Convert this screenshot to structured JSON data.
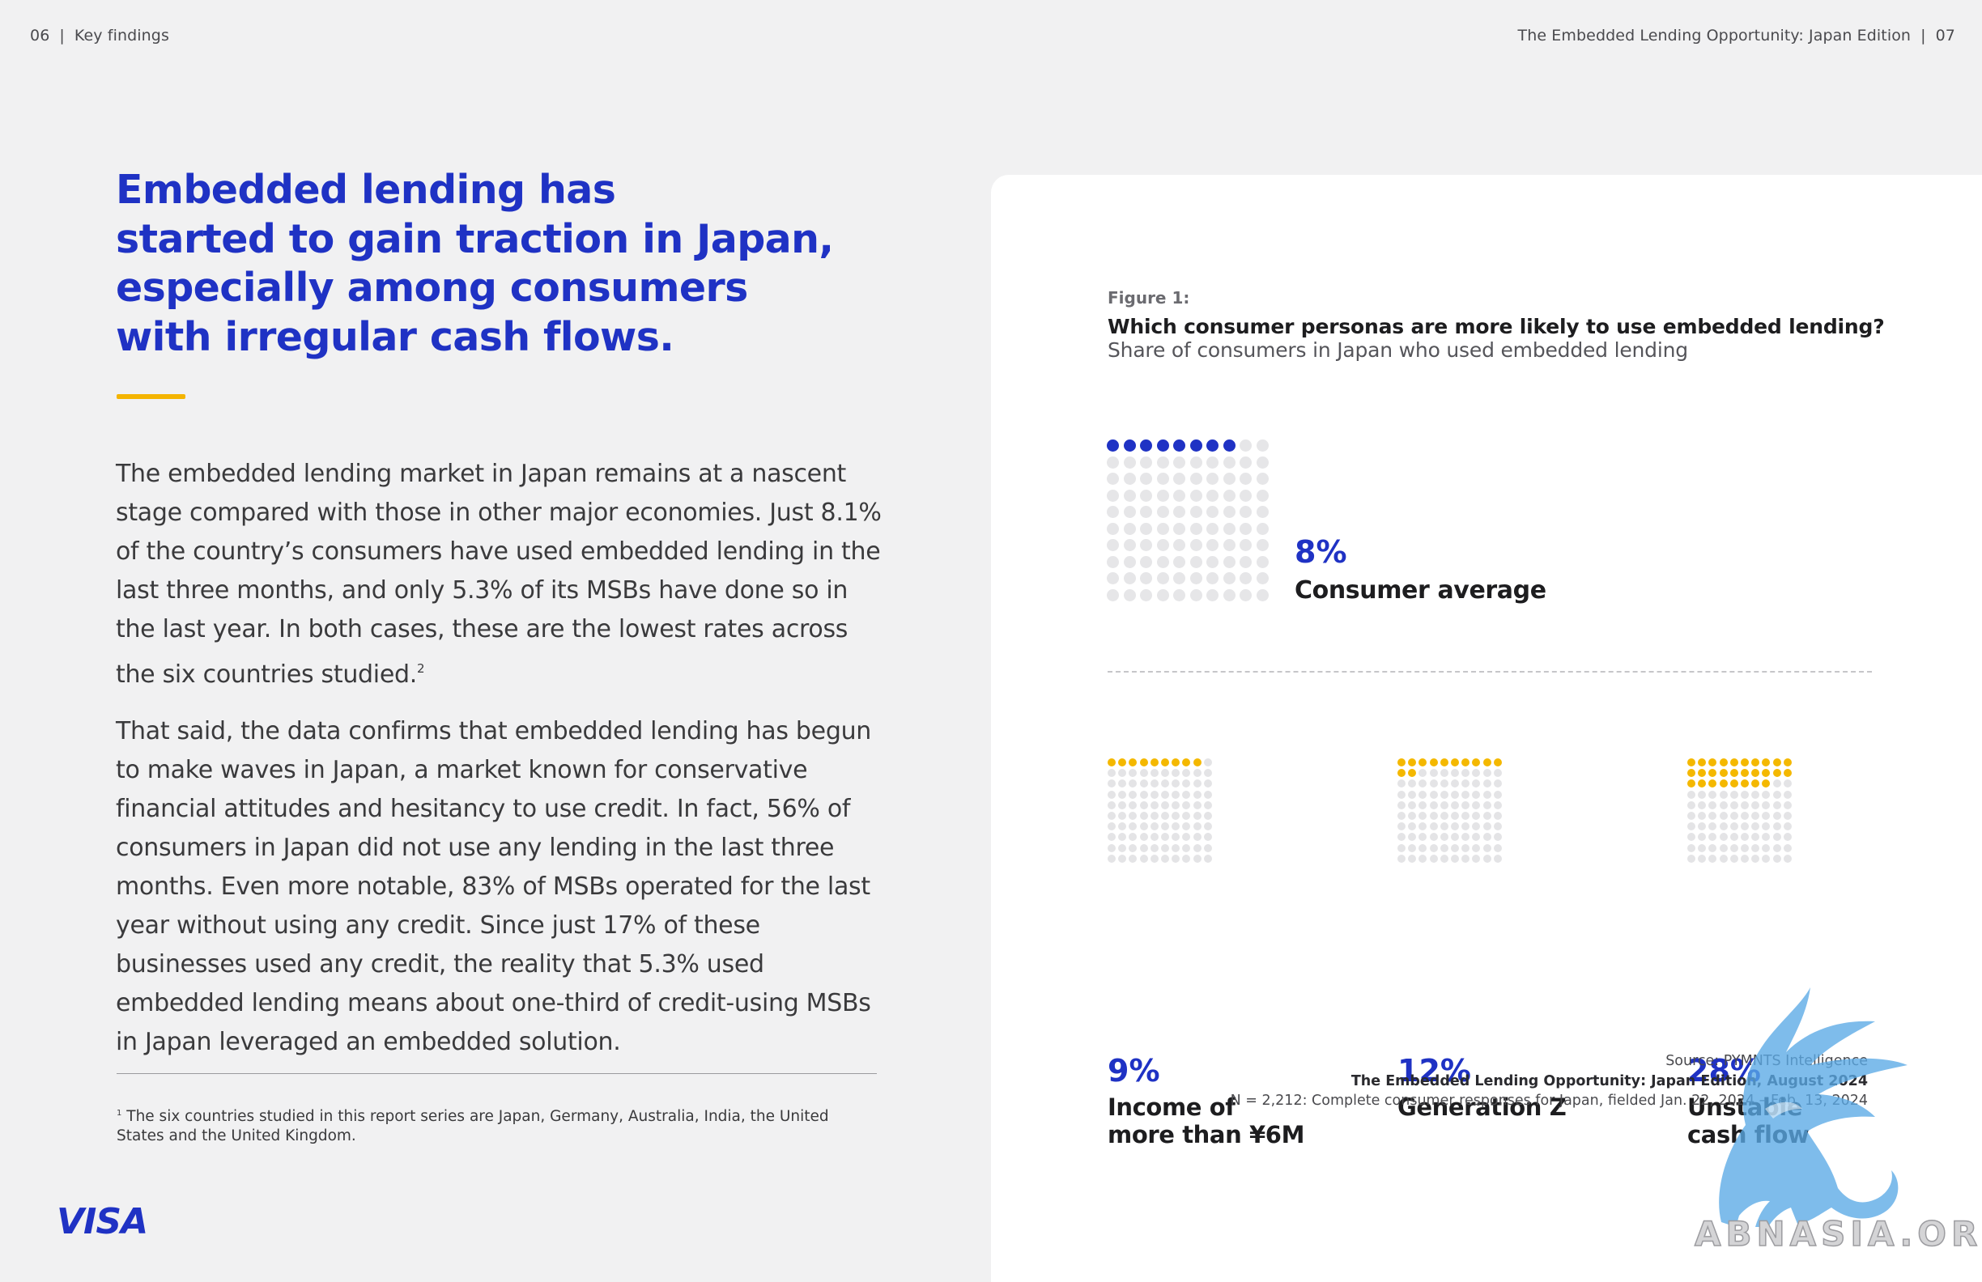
{
  "header": {
    "left_page": "06",
    "left_section": "Key findings",
    "right_title": "The Embedded Lending Opportunity: Japan Edition",
    "right_page": "07"
  },
  "headline": {
    "line1": "Embedded lending has",
    "line2": "started to gain traction in Japan,",
    "line3": "especially among consumers",
    "line4": "with irregular cash flows."
  },
  "body": {
    "p1": "The embedded lending market in Japan remains at a nascent stage compared with those in other major economies. Just 8.1% of the country’s consumers have used embedded lending in the last three months, and only 5.3% of its MSBs have done so in the last year. In both cases, these are the lowest rates across the six countries studied.",
    "p1_sup": "2",
    "p2": "That said, the data confirms that embedded lending has begun to make waves in Japan, a market known for conservative financial attitudes and hesitancy to use credit. In fact, 56% of consumers in Japan did not use any lending in the last three months. Even more notable, 83% of MSBs operated for the last year without using any credit. Since just 17% of these businesses used any credit, the reality that 5.3% used embedded lending means about one-third of credit-using MSBs in Japan leveraged an embedded solution."
  },
  "footnote": {
    "marker": "1",
    "text": "The six countries studied in this report series are Japan, Germany, Australia, India, the United States and the United Kingdom."
  },
  "logo": {
    "text": "VISA"
  },
  "figure": {
    "label": "Figure 1:",
    "question": "Which consumer personas are more likely to use embedded lending?",
    "subtitle": "Share of consumers in Japan who used embedded lending",
    "colors": {
      "primary": "#1f32c4",
      "accent": "#f4b800",
      "empty": "#e6e6e8"
    }
  },
  "chart_data": {
    "type": "waffle",
    "title": "Which consumer personas are more likely to use embedded lending?",
    "subtitle": "Share of consumers in Japan who used embedded lending",
    "units": "%",
    "grid": "10x10",
    "series": [
      {
        "name": "Consumer average",
        "value": 8,
        "label": "8%",
        "color": "#1f32c4"
      },
      {
        "name": "Income of more than ¥6M",
        "value": 9,
        "label": "9%",
        "color": "#f4b800"
      },
      {
        "name": "Generation Z",
        "value": 12,
        "label": "12%",
        "color": "#f4b800"
      },
      {
        "name": "Unstable cash flow",
        "value": 28,
        "label": "28%",
        "color": "#f4b800"
      }
    ]
  },
  "average": {
    "pct": "8%",
    "label": "Consumer average"
  },
  "personas": [
    {
      "pct": "9%",
      "line1": "Income of",
      "line2": "more than ¥6M"
    },
    {
      "pct": "12%",
      "line1": "Generation Z",
      "line2": ""
    },
    {
      "pct": "28%",
      "line1": "Unstable",
      "line2": "cash flow"
    }
  ],
  "source": {
    "line1": "Source: PYMNTS Intelligence",
    "line2": "The Embedded Lending Opportunity: Japan Edition, August 2024",
    "line3": "N = 2,212: Complete consumer responses for Japan, fielded Jan. 22, 2024 – Feb. 13, 2024"
  },
  "watermark": {
    "text": "ABNASIA.ORG"
  }
}
